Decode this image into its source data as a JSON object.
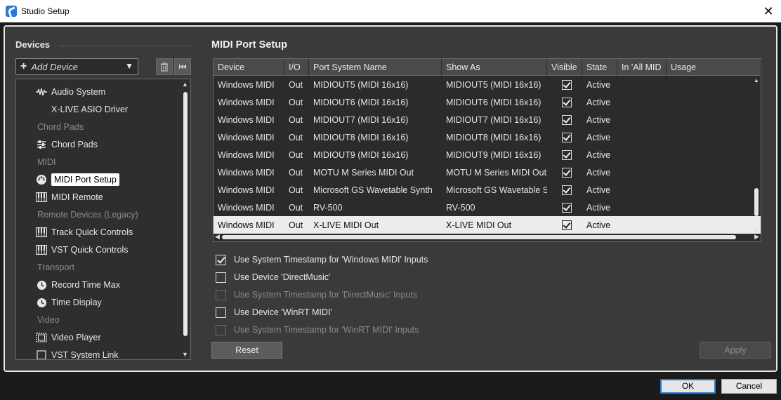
{
  "window": {
    "title": "Studio Setup"
  },
  "devices": {
    "heading": "Devices",
    "add_device_label": "Add Device",
    "tree": [
      {
        "label": "Audio System",
        "kind": "item",
        "icon": "audio-wave-icon",
        "indent": 1
      },
      {
        "label": "X-LIVE ASIO Driver",
        "kind": "item",
        "icon": "",
        "indent": 2
      },
      {
        "label": "Chord Pads",
        "kind": "category"
      },
      {
        "label": "Chord Pads",
        "kind": "item",
        "icon": "sliders-icon",
        "indent": 1
      },
      {
        "label": "MIDI",
        "kind": "category"
      },
      {
        "label": "MIDI Port Setup",
        "kind": "item",
        "icon": "midi-port-icon",
        "indent": 1,
        "selected": true
      },
      {
        "label": "MIDI Remote",
        "kind": "item",
        "icon": "keyboard-icon",
        "indent": 1
      },
      {
        "label": "Remote Devices (Legacy)",
        "kind": "category"
      },
      {
        "label": "Track Quick Controls",
        "kind": "item",
        "icon": "keyboard-icon",
        "indent": 1
      },
      {
        "label": "VST Quick Controls",
        "kind": "item",
        "icon": "keyboard-icon",
        "indent": 1
      },
      {
        "label": "Transport",
        "kind": "category"
      },
      {
        "label": "Record Time Max",
        "kind": "item",
        "icon": "clock-icon",
        "indent": 1
      },
      {
        "label": "Time Display",
        "kind": "item",
        "icon": "clock-icon",
        "indent": 1
      },
      {
        "label": "Video",
        "kind": "category"
      },
      {
        "label": "Video Player",
        "kind": "item",
        "icon": "film-icon",
        "indent": 1
      },
      {
        "label": "VST System Link",
        "kind": "item",
        "icon": "link-box-icon",
        "indent": 0
      }
    ]
  },
  "midi_port_setup": {
    "heading": "MIDI Port Setup",
    "columns": [
      "Device",
      "I/O",
      "Port System Name",
      "Show As",
      "Visible",
      "State",
      "In 'All MID",
      "Usage"
    ],
    "rows": [
      {
        "device": "Windows MIDI",
        "io": "Out",
        "port": "MIDIOUT5 (MIDI 16x16)",
        "show_as": "MIDIOUT5 (MIDI 16x16)",
        "visible": true,
        "state": "Active",
        "in_all": "",
        "usage": ""
      },
      {
        "device": "Windows MIDI",
        "io": "Out",
        "port": "MIDIOUT6 (MIDI 16x16)",
        "show_as": "MIDIOUT6 (MIDI 16x16)",
        "visible": true,
        "state": "Active",
        "in_all": "",
        "usage": ""
      },
      {
        "device": "Windows MIDI",
        "io": "Out",
        "port": "MIDIOUT7 (MIDI 16x16)",
        "show_as": "MIDIOUT7 (MIDI 16x16)",
        "visible": true,
        "state": "Active",
        "in_all": "",
        "usage": ""
      },
      {
        "device": "Windows MIDI",
        "io": "Out",
        "port": "MIDIOUT8 (MIDI 16x16)",
        "show_as": "MIDIOUT8 (MIDI 16x16)",
        "visible": true,
        "state": "Active",
        "in_all": "",
        "usage": ""
      },
      {
        "device": "Windows MIDI",
        "io": "Out",
        "port": "MIDIOUT9 (MIDI 16x16)",
        "show_as": "MIDIOUT9 (MIDI 16x16)",
        "visible": true,
        "state": "Active",
        "in_all": "",
        "usage": ""
      },
      {
        "device": "Windows MIDI",
        "io": "Out",
        "port": "MOTU M Series MIDI Out",
        "show_as": "MOTU M Series MIDI Out",
        "visible": true,
        "state": "Active",
        "in_all": "",
        "usage": ""
      },
      {
        "device": "Windows MIDI",
        "io": "Out",
        "port": "Microsoft GS Wavetable Synth",
        "show_as": "Microsoft GS Wavetable Synth",
        "visible": true,
        "state": "Active",
        "in_all": "",
        "usage": ""
      },
      {
        "device": "Windows MIDI",
        "io": "Out",
        "port": "RV-500",
        "show_as": "RV-500",
        "visible": true,
        "state": "Active",
        "in_all": "",
        "usage": ""
      },
      {
        "device": "Windows MIDI",
        "io": "Out",
        "port": "X-LIVE MIDI Out",
        "show_as": "X-LIVE MIDI Out",
        "visible": true,
        "state": "Active",
        "in_all": "",
        "usage": "",
        "selected": true
      }
    ],
    "options": [
      {
        "label": "Use System Timestamp for 'Windows MIDI' Inputs",
        "checked": true,
        "disabled": false
      },
      {
        "label": "Use Device 'DirectMusic'",
        "checked": false,
        "disabled": false
      },
      {
        "label": "Use System Timestamp for 'DirectMusic' Inputs",
        "checked": false,
        "disabled": true
      },
      {
        "label": "Use Device 'WinRT MIDI'",
        "checked": false,
        "disabled": false
      },
      {
        "label": "Use System Timestamp for 'WinRT MIDI' Inputs",
        "checked": false,
        "disabled": true
      }
    ],
    "reset_label": "Reset",
    "apply_label": "Apply"
  },
  "footer": {
    "ok_label": "OK",
    "cancel_label": "Cancel"
  },
  "colors": {
    "accent": "#2a7bd4",
    "panel": "#3a3a3a",
    "selected_row": "#ececec"
  }
}
